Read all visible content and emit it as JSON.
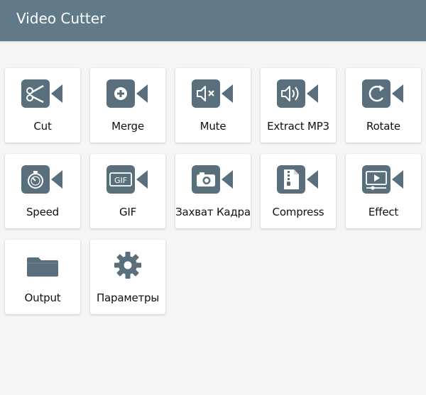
{
  "app": {
    "title": "Video Cutter",
    "colors": {
      "appbar": "#617a89",
      "icon": "#5a6f7c",
      "background": "#f5f5f5",
      "tile": "#ffffff"
    }
  },
  "tiles": [
    {
      "label": "Cut",
      "icon": "scissors-camera-icon"
    },
    {
      "label": "Merge",
      "icon": "plus-camera-icon"
    },
    {
      "label": "Mute",
      "icon": "mute-camera-icon"
    },
    {
      "label": "Extract MP3",
      "icon": "speaker-camera-icon"
    },
    {
      "label": "Rotate",
      "icon": "rotate-camera-icon"
    },
    {
      "label": "Speed",
      "icon": "stopwatch-camera-icon"
    },
    {
      "label": "GIF",
      "icon": "gif-camera-icon",
      "icon_text": "GIF"
    },
    {
      "label": "Захват Кадра",
      "icon": "photo-camera-icon"
    },
    {
      "label": "Compress",
      "icon": "zip-file-camera-icon"
    },
    {
      "label": "Effect",
      "icon": "effect-camera-icon"
    },
    {
      "label": "Output",
      "icon": "folder-icon"
    },
    {
      "label": "Параметры",
      "icon": "gear-icon"
    }
  ]
}
